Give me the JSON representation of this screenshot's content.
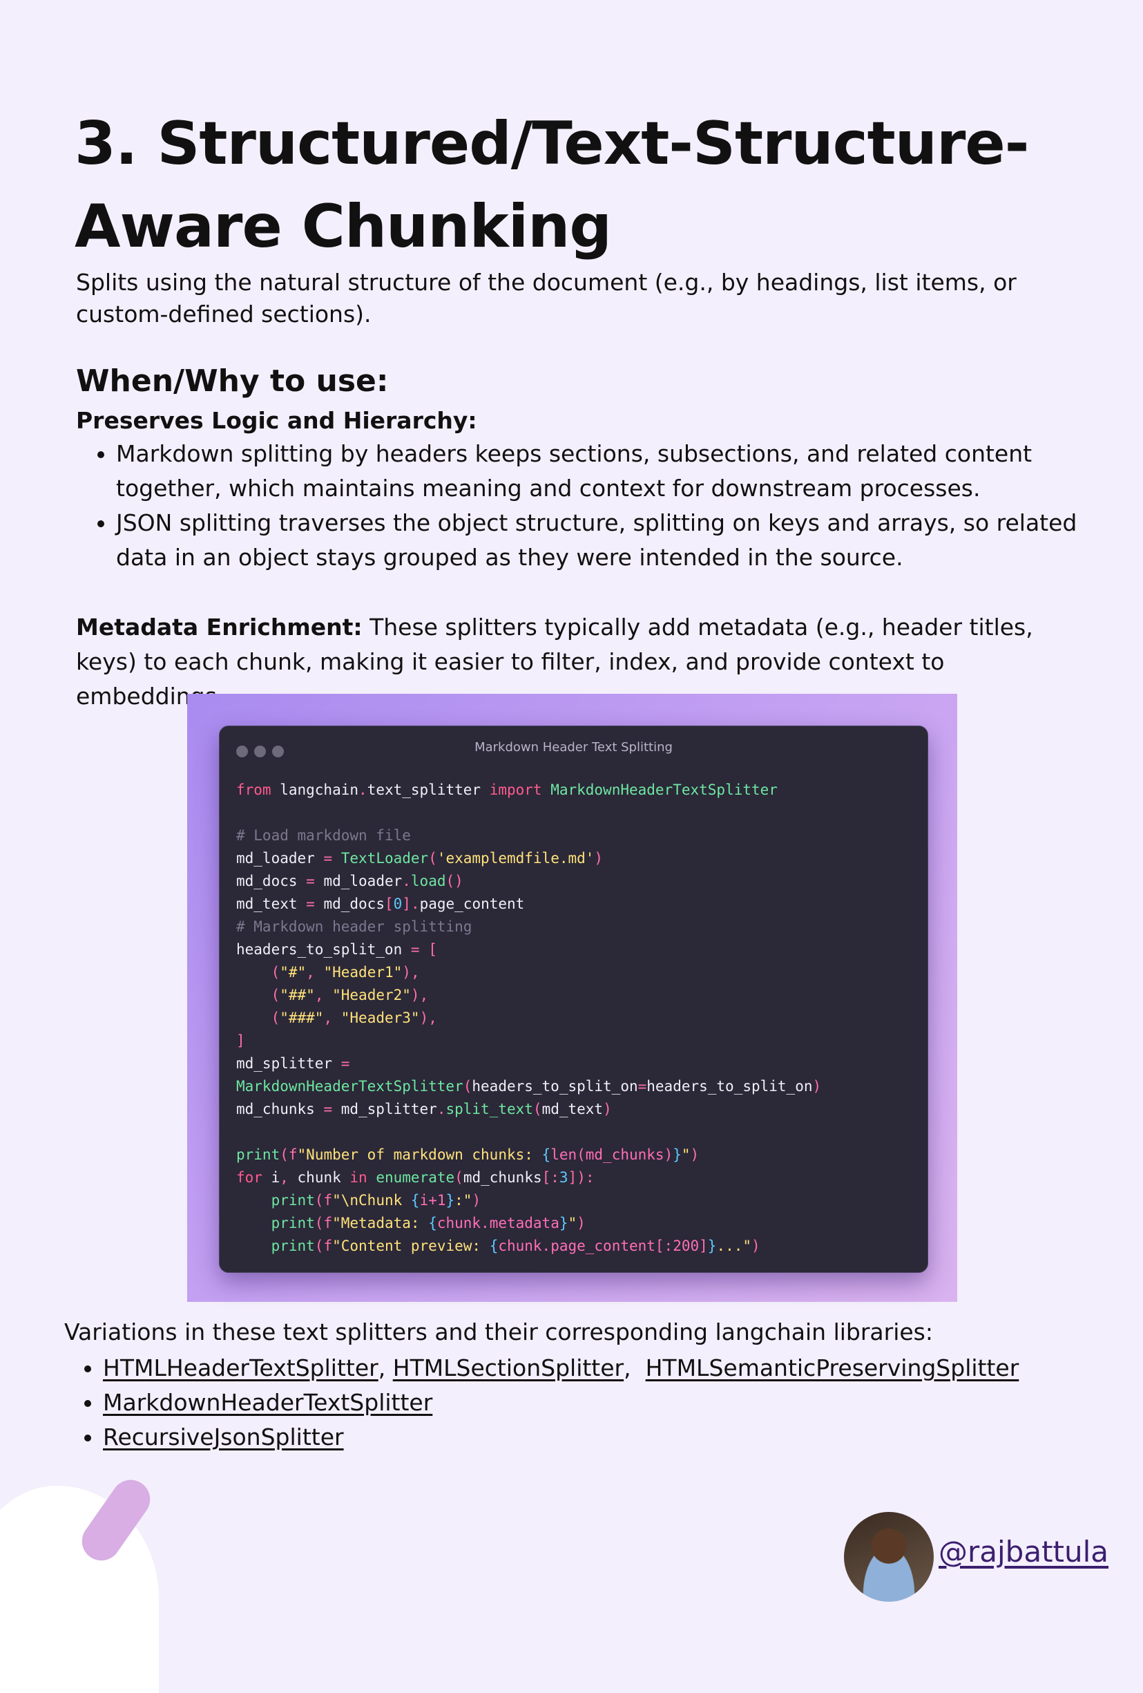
{
  "title_line1": "3. Structured/Text-Structure-",
  "title_line2": "Aware Chunking",
  "subtitle": "Splits using the natural structure of the document (e.g., by headings, list items, or custom-defined sections).",
  "when_why": {
    "heading": "When/Why to use:",
    "subheading": "Preserves Logic and Hierarchy:",
    "bullets": [
      "Markdown splitting by headers keeps sections, subsections, and related content together, which maintains meaning and context for downstream processes.",
      "JSON splitting traverses the object structure, splitting on keys and arrays, so related data in an object stays grouped as they were intended in the source."
    ]
  },
  "metadata": {
    "label": "Metadata Enrichment:",
    "text": " These splitters typically add metadata (e.g., header titles, keys) to each chunk, making it easier to filter, index, and provide context to embeddings."
  },
  "code_window": {
    "title": "Markdown Header Text Splitting",
    "lines": [
      "from langchain.text_splitter import MarkdownHeaderTextSplitter",
      "",
      "# Load markdown file",
      "md_loader = TextLoader('examplemdfile.md')",
      "md_docs = md_loader.load()",
      "md_text = md_docs[0].page_content",
      "# Markdown header splitting",
      "headers_to_split_on = [",
      "    (\"#\", \"Header1\"),",
      "    (\"##\", \"Header2\"),",
      "    (\"###\", \"Header3\"),",
      "]",
      "md_splitter =",
      "MarkdownHeaderTextSplitter(headers_to_split_on=headers_to_split_on)",
      "md_chunks = md_splitter.split_text(md_text)",
      "",
      "print(f\"Number of markdown chunks: {len(md_chunks)}\")",
      "for i, chunk in enumerate(md_chunks[:3]):",
      "    print(f\"\\nChunk {i+1}:\")",
      "    print(f\"Metadata: {chunk.metadata}\")",
      "    print(f\"Content preview: {chunk.page_content[:200]}...\")"
    ]
  },
  "variations": {
    "intro": "Variations in these text splitters and their corresponding langchain libraries:",
    "line1": [
      "HTMLHeaderTextSplitter",
      "HTMLSectionSplitter",
      "HTMLSemanticPreservingSplitter"
    ],
    "line2": "MarkdownHeaderTextSplitter",
    "line3": "RecursiveJsonSplitter"
  },
  "author": {
    "handle": "@rajbattula"
  }
}
